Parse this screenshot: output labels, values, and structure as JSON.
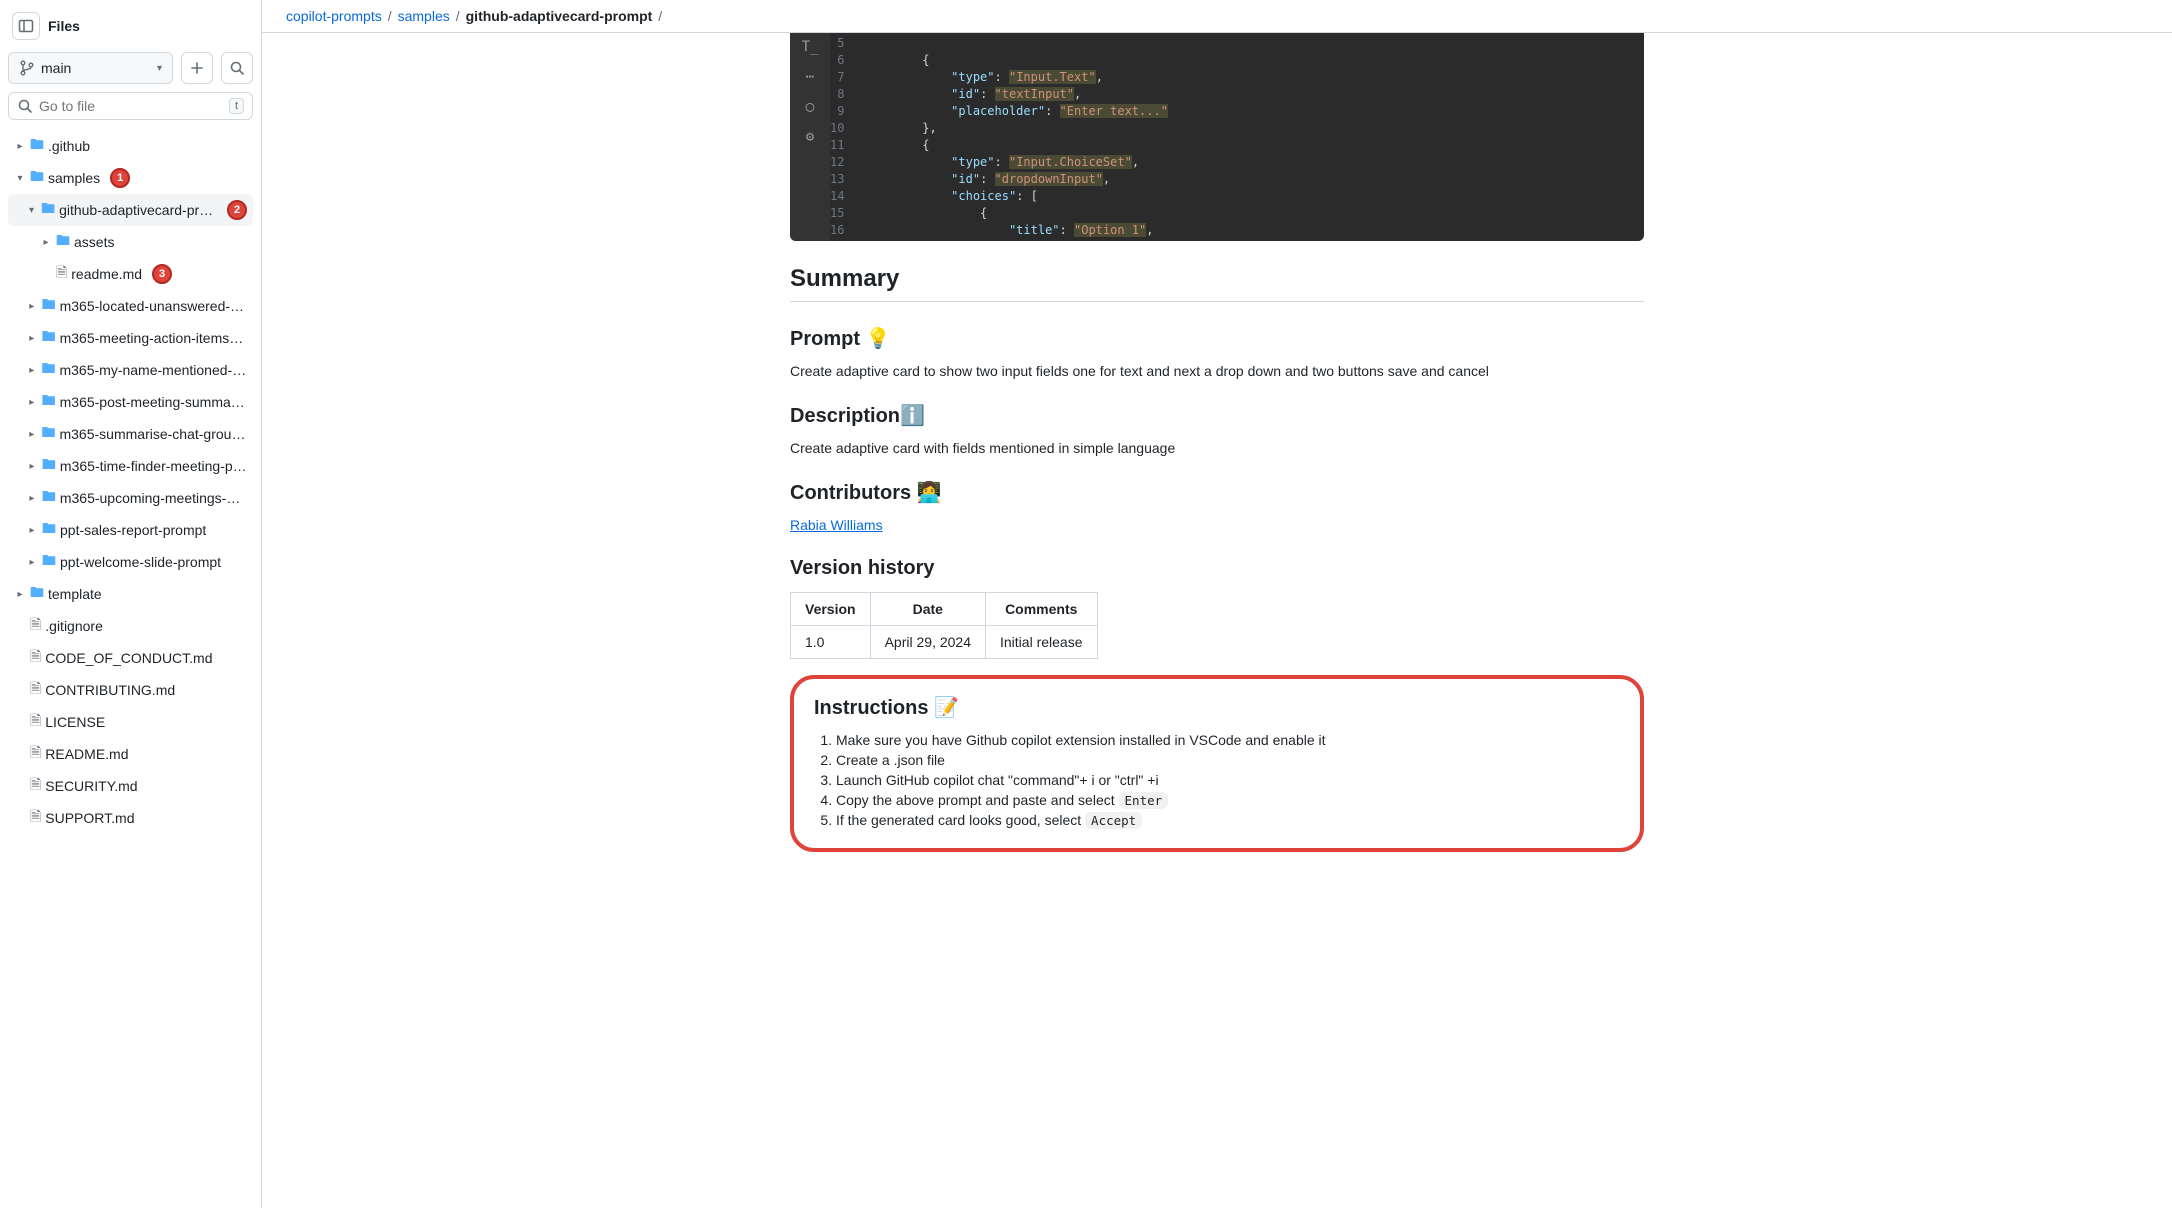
{
  "sidebar": {
    "title": "Files",
    "branch": "main",
    "gotoPlaceholder": "Go to file",
    "gotoKey": "t"
  },
  "tree": {
    "github": ".github",
    "samples": "samples",
    "adaptive": "github-adaptivecard-prompt",
    "assets": "assets",
    "readmemd": "readme.md",
    "m365_1": "m365-located-unanswered-m...",
    "m365_2": "m365-meeting-action-items-p...",
    "m365_3": "m365-my-name-mentioned-pr...",
    "m365_4": "m365-post-meeting-summary...",
    "m365_5": "m365-summarise-chat-group-...",
    "m365_6": "m365-time-finder-meeting-pr...",
    "m365_7": "m365-upcoming-meetings-pr...",
    "ppt1": "ppt-sales-report-prompt",
    "ppt2": "ppt-welcome-slide-prompt",
    "template": "template",
    "gitignore": ".gitignore",
    "coc": "CODE_OF_CONDUCT.md",
    "contrib": "CONTRIBUTING.md",
    "license": "LICENSE",
    "readme": "README.md",
    "security": "SECURITY.md",
    "support": "SUPPORT.md",
    "badge1": "1",
    "badge2": "2",
    "badge3": "3"
  },
  "breadcrumb": {
    "root": "copilot-prompts",
    "samples": "samples",
    "current": "github-adaptivecard-prompt"
  },
  "code": {
    "lines": [
      "5",
      "6",
      "7",
      "8",
      "9",
      "10",
      "11",
      "12",
      "13",
      "14",
      "15",
      "16"
    ]
  },
  "readme": {
    "summary": "Summary",
    "promptHeading": "Prompt 💡",
    "promptText": "Create adaptive card to show two input fields one for text and next a drop down and two buttons save and cancel",
    "descHeading": "Descriptionℹ️",
    "descText": "Create adaptive card with fields mentioned in simple language",
    "contribHeading": "Contributors 👩‍💻",
    "contributor": "Rabia Williams",
    "versionHeading": "Version history",
    "table": {
      "hVersion": "Version",
      "hDate": "Date",
      "hComments": "Comments",
      "v": "1.0",
      "d": "April 29, 2024",
      "c": "Initial release"
    },
    "instrHeading": "Instructions 📝",
    "steps": {
      "s1": "Make sure you have Github copilot extension installed in VSCode and enable it",
      "s2": "Create a .json file",
      "s3": "Launch GitHub copilot chat \"command\"+ i or \"ctrl\" +i",
      "s4a": "Copy the above prompt and paste and select ",
      "s4b": "Enter",
      "s5a": "If the generated card looks good, select ",
      "s5b": "Accept"
    }
  }
}
